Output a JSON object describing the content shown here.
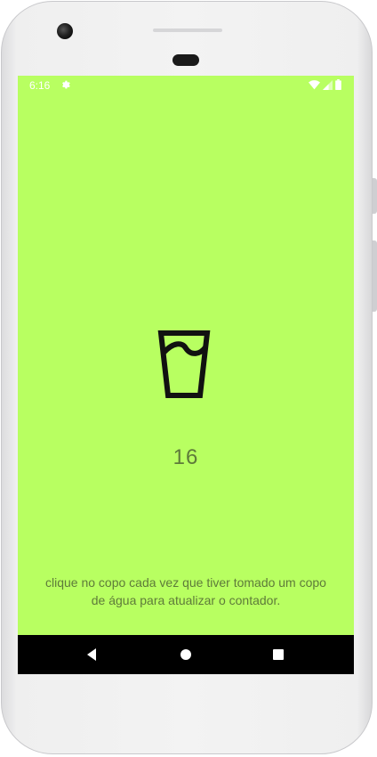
{
  "status_bar": {
    "time": "6:16",
    "icons": [
      "gear-icon",
      "wifi-icon",
      "signal-icon",
      "battery-icon"
    ]
  },
  "main": {
    "glass_icon": "water-glass-icon",
    "counter": "16",
    "instructions": "clique no copo cada vez que tiver tomado um copo de água para atualizar o contador."
  },
  "nav_bar": {
    "buttons": [
      "back-icon",
      "home-icon",
      "recents-icon"
    ]
  },
  "colors": {
    "screen_background": "#b8ff61",
    "text": "#5e7a3a",
    "glass_stroke": "#111111",
    "nav_background": "#000000"
  }
}
